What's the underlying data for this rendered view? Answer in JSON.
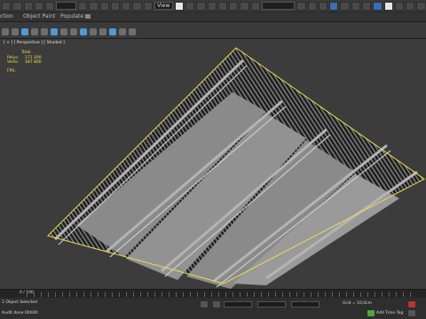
{
  "menu": {
    "tab_selection": "ction",
    "tab_object_paint": "Object Paint",
    "tab_populate": "Populate"
  },
  "toolbar": {
    "view_dropdown": "View"
  },
  "viewport": {
    "label": "[ + ] [ Perspective ] [ Shaded ]",
    "stats_title": "Total",
    "stats_polys_label": "Polys:",
    "stats_polys_value": "171 200",
    "stats_verts_label": "Verts:",
    "stats_verts_value": "187 800",
    "stats_fps_label": "FPS:"
  },
  "timeline": {
    "frame_counter": "0 / 100"
  },
  "status": {
    "selection_text": "1 Object Selected",
    "bottom_left_text": "Audit done 00h00:",
    "grid_label": "Grid = 10,0cm",
    "add_time_tag": "Add Time Tag"
  },
  "colors": {
    "selection_box": "#e7e24a",
    "toolbar_accent": "#3b6fb5",
    "background": "#3c3c3c"
  }
}
